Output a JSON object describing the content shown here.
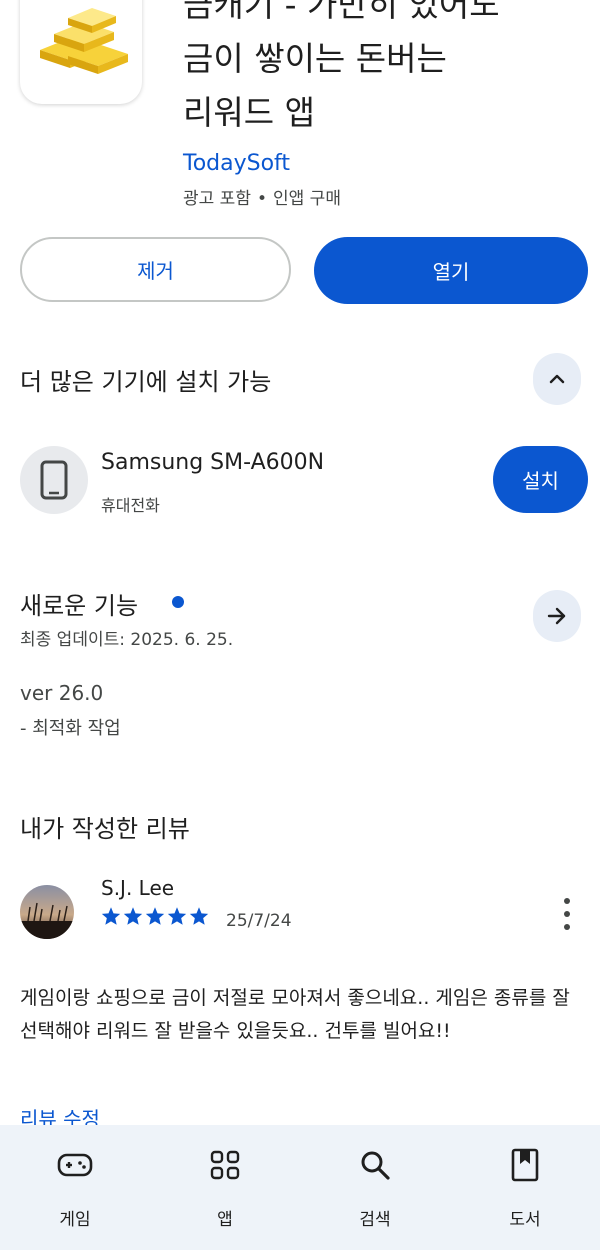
{
  "app": {
    "title": "금캐기 - 가만히 있어도\n금이 쌓이는 돈버는\n리워드 앱",
    "developer": "TodaySoft",
    "meta_ads": "광고 포함",
    "meta_separator": "•",
    "meta_iap": "인앱 구매"
  },
  "actions": {
    "uninstall_label": "제거",
    "open_label": "열기"
  },
  "devices": {
    "title": "더 많은 기기에 설치 가능",
    "device_name": "Samsung SM-A600N",
    "device_type": "휴대전화",
    "install_label": "설치"
  },
  "whats_new": {
    "title": "새로운 기능",
    "last_updated": "최종 업데이트: 2025. 6. 25.",
    "version": "ver 26.0",
    "note": "- 최적화 작업"
  },
  "my_review": {
    "title": "내가 작성한 리뷰",
    "reviewer_name": "S.J. Lee",
    "rating": 5,
    "date": "25/7/24",
    "text": "게임이랑 쇼핑으로 금이 저절로 모아져서 좋으네요.. 게임은 종류를 잘 선택해야 리워드 잘 받을수 있을듯요.. 건투를 빌어요!!",
    "edit_label": "리뷰 수정"
  },
  "bottom_nav": {
    "items": [
      {
        "label": "게임",
        "icon": "gamepad-icon"
      },
      {
        "label": "앱",
        "icon": "apps-grid-icon"
      },
      {
        "label": "검색",
        "icon": "search-icon"
      },
      {
        "label": "도서",
        "icon": "book-icon"
      }
    ]
  },
  "colors": {
    "accent": "#0b57d0",
    "star": "#0b57d0",
    "nav_background": "#eef3f9"
  }
}
